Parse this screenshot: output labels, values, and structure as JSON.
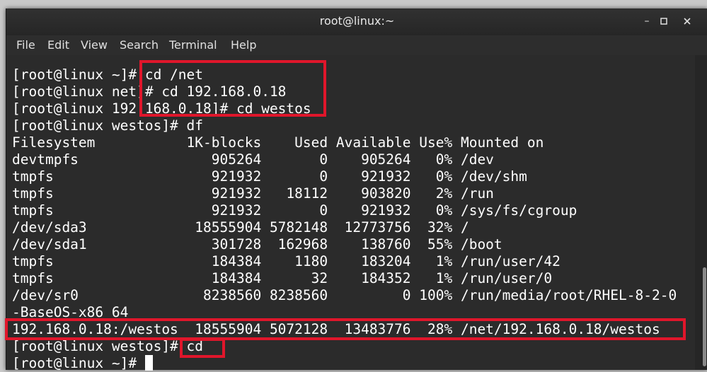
{
  "window": {
    "title": "root@linux:~",
    "controls": {
      "minimize": "–",
      "maximize": "□",
      "close": "×"
    }
  },
  "menu": [
    "File",
    "Edit",
    "View",
    "Search",
    "Terminal",
    "Help"
  ],
  "terminal": {
    "lines": [
      "[root@linux ~]# cd /net",
      "[root@linux net]# cd 192.168.0.18",
      "[root@linux 192.168.0.18]# cd westos",
      "[root@linux westos]# df",
      "Filesystem           1K-blocks    Used Available Use% Mounted on",
      "devtmpfs                905264       0    905264   0% /dev",
      "tmpfs                   921932       0    921932   0% /dev/shm",
      "tmpfs                   921932   18112    903820   2% /run",
      "tmpfs                   921932       0    921932   0% /sys/fs/cgroup",
      "/dev/sda3             18555904 5782148  12773756  32% /",
      "/dev/sda1               301728  162968    138760  55% /boot",
      "tmpfs                   184384    1180    183204   1% /run/user/42",
      "tmpfs                   184384      32    184352   1% /run/user/0",
      "/dev/sr0               8238560 8238560         0 100% /run/media/root/RHEL-8-2-0",
      "-BaseOS-x86_64",
      "192.168.0.18:/westos  18555904 5072128  13483776  28% /net/192.168.0.18/westos",
      "[root@linux westos]# cd",
      "[root@linux ~]# "
    ]
  },
  "colors": {
    "terminal_bg": "#2b2b2b",
    "text": "#ffffff",
    "highlight": "#e0162b"
  }
}
